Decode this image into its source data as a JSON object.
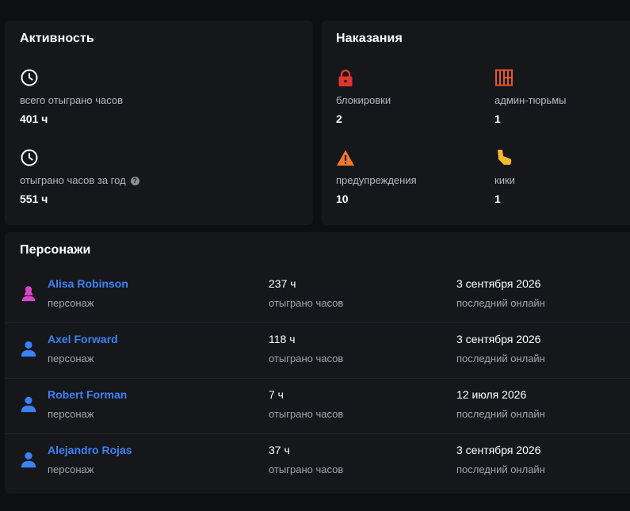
{
  "activity": {
    "title": "Активность",
    "total_hours_label": "всего отыграно часов",
    "total_hours_value": "401 ч",
    "year_hours_label": "отыграно часов за год",
    "year_hours_value": "551 ч",
    "help_glyph": "?",
    "icon": "clock-icon"
  },
  "punishments": {
    "title": "Наказания",
    "bans_label": "блокировки",
    "bans_value": "2",
    "jails_label": "админ-тюрьмы",
    "jails_value": "1",
    "warnings_label": "предупреждения",
    "warnings_value": "10",
    "kicks_label": "кики",
    "kicks_value": "1",
    "colors": {
      "ban": "#e0362c",
      "jail": "#e8572a",
      "warning": "#f5782a",
      "kick": "#f5b82e"
    }
  },
  "characters": {
    "title": "Персонажи",
    "hours_label": "отыграно часов",
    "online_label": "последний онлайн",
    "role_label": "персонаж",
    "items": [
      {
        "name": "Alisa Robinson",
        "role": "персонаж",
        "hours": "237 ч",
        "hours_label": "отыграно часов",
        "last_online": "3 сентября 2026",
        "last_online_label": "последний онлайн",
        "avatar": "female-user-icon",
        "avatar_color": "#d946c8"
      },
      {
        "name": "Axel Forward",
        "role": "персонаж",
        "hours": "118 ч",
        "hours_label": "отыграно часов",
        "last_online": "3 сентября 2026",
        "last_online_label": "последний онлайн",
        "avatar": "male-user-icon",
        "avatar_color": "#3b82f6"
      },
      {
        "name": "Robert Forman",
        "role": "персонаж",
        "hours": "7 ч",
        "hours_label": "отыграно часов",
        "last_online": "12 июля 2026",
        "last_online_label": "последний онлайн",
        "avatar": "male-user-icon",
        "avatar_color": "#3b82f6"
      },
      {
        "name": "Alejandro Rojas",
        "role": "персонаж",
        "hours": "37 ч",
        "hours_label": "отыграно часов",
        "last_online": "3 сентября 2026",
        "last_online_label": "последний онлайн",
        "avatar": "male-user-icon",
        "avatar_color": "#3b82f6"
      }
    ]
  }
}
